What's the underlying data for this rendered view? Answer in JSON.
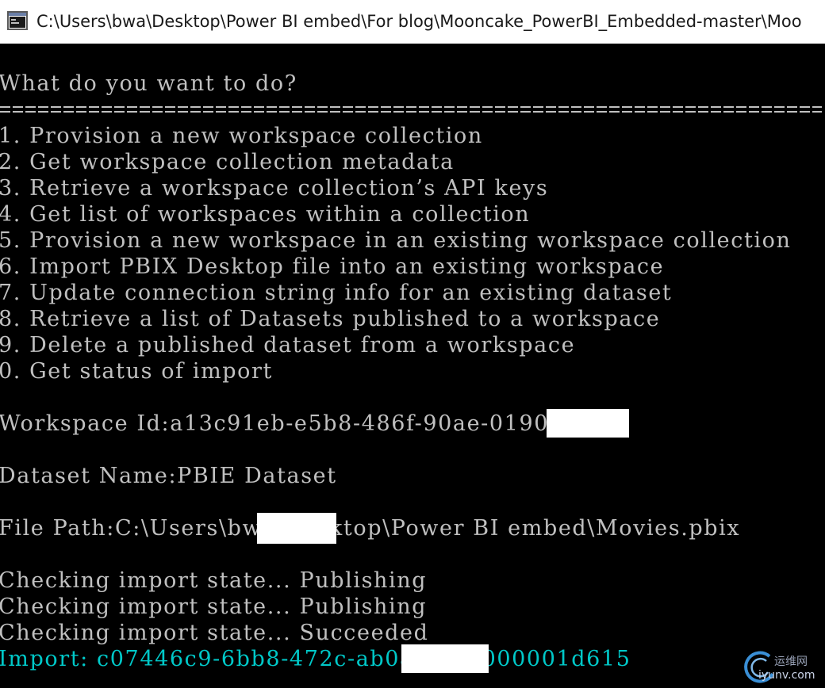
{
  "window": {
    "title": "C:\\Users\\bwa\\Desktop\\Power BI embed\\For blog\\Mooncake_PowerBI_Embedded-master\\Moo"
  },
  "console": {
    "prompt": "What do you want to do?",
    "separator": "===============================================================",
    "menu": [
      "1. Provision a new workspace collection",
      "2. Get workspace collection metadata",
      "3. Retrieve a workspace collection’s API keys",
      "4. Get list of workspaces within a collection",
      "5. Provision a new workspace in an existing workspace collection",
      "6. Import PBIX Desktop file into an existing workspace",
      "7. Update connection string info for an existing dataset",
      "8. Retrieve a list of Datasets published to a workspace",
      "9. Delete a published dataset from a workspace",
      "0. Get status of import"
    ],
    "workspace_line": "Workspace Id:a13c91eb-e5b8-486f-90ae-0190db0",
    "dataset_line": "Dataset Name:PBIE Dataset",
    "filepath_line": "File Path:C:\\Users\\bwa\\Desktop\\Power BI embed\\Movies.pbix",
    "status_lines": [
      "Checking import state... Publishing",
      "Checking import state... Publishing",
      "Checking import state... Succeeded"
    ],
    "import_line": "Import: c07446c9-6bb8-472c-ab0a-0000000001d615",
    "text_color": "#c0c0c0",
    "highlight_color": "#00c8c8"
  },
  "watermark": {
    "cn": "运维网",
    "en": "iyunv.com"
  }
}
